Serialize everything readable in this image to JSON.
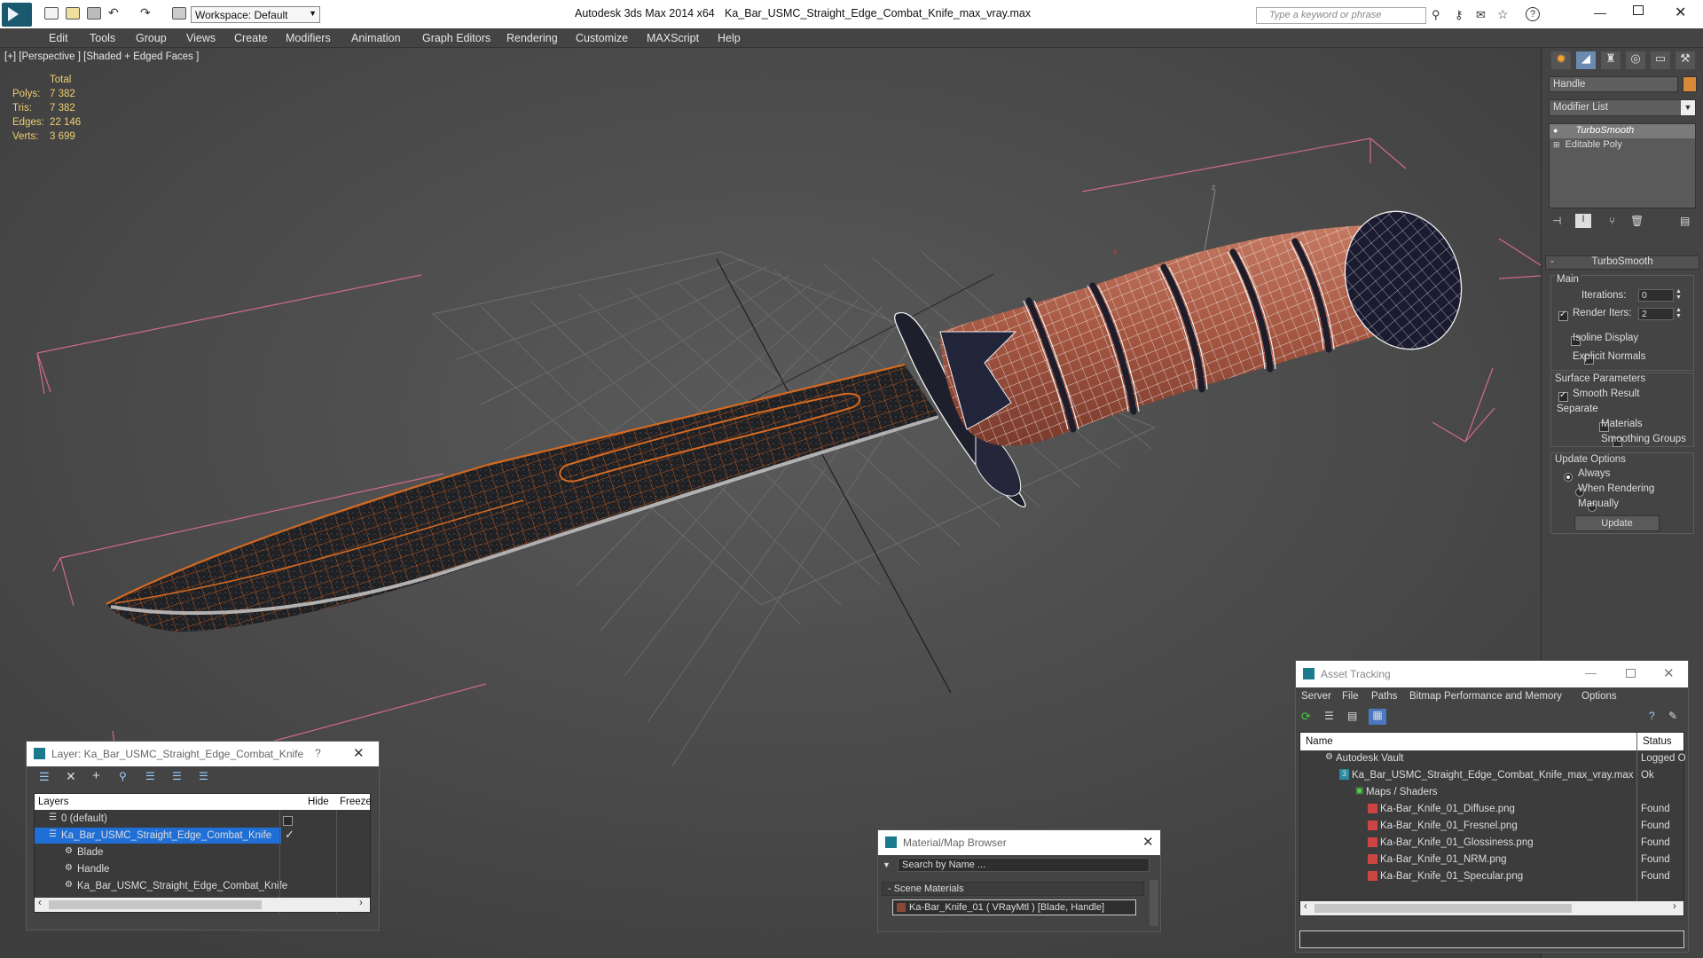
{
  "titlebar": {
    "workspace": "Workspace: Default",
    "app_title": "Autodesk 3ds Max  2014 x64",
    "file_title": "Ka_Bar_USMC_Straight_Edge_Combat_Knife_max_vray.max",
    "search_placeholder": "Type a keyword or phrase"
  },
  "menubar": [
    "Edit",
    "Tools",
    "Group",
    "Views",
    "Create",
    "Modifiers",
    "Animation",
    "Graph Editors",
    "Rendering",
    "Customize",
    "MAXScript",
    "Help"
  ],
  "viewport": {
    "label": "[+] [Perspective ] [Shaded + Edged Faces ]",
    "stats_header": "Total",
    "stats": [
      {
        "label": "Polys:",
        "value": "7 382"
      },
      {
        "label": "Tris:",
        "value": "7 382"
      },
      {
        "label": "Edges:",
        "value": "22 146"
      },
      {
        "label": "Verts:",
        "value": "3 699"
      }
    ],
    "axis_x": "x",
    "axis_z": "z"
  },
  "cmdpanel": {
    "object_name": "Handle",
    "modifier_list": "Modifier List",
    "stack": [
      "TurboSmooth",
      "Editable Poly"
    ],
    "rollout_title": "TurboSmooth",
    "main_label": "Main",
    "iterations_label": "Iterations:",
    "iterations_value": "0",
    "render_iters_label": "Render Iters:",
    "render_iters_value": "2",
    "isoline": "Isoline Display",
    "explicit_normals": "Explicit Normals",
    "surface_params": "Surface Parameters",
    "smooth_result": "Smooth Result",
    "separate": "Separate",
    "materials": "Materials",
    "smoothing_groups": "Smoothing Groups",
    "update_options": "Update Options",
    "always": "Always",
    "when_rendering": "When Rendering",
    "manually": "Manually",
    "update_btn": "Update"
  },
  "layer_win": {
    "title": "Layer: Ka_Bar_USMC_Straight_Edge_Combat_Knife",
    "help": "?",
    "col_layers": "Layers",
    "col_hide": "Hide",
    "col_freeze": "Freeze",
    "rows": [
      "0 (default)",
      "Ka_Bar_USMC_Straight_Edge_Combat_Knife",
      "Blade",
      "Handle",
      "Ka_Bar_USMC_Straight_Edge_Combat_Knife"
    ]
  },
  "mat_browser": {
    "title": "Material/Map Browser",
    "search_placeholder": "Search by Name ...",
    "section": "- Scene Materials",
    "material": "Ka-Bar_Knife_01  ( VRayMtl ) [Blade, Handle]"
  },
  "asset_win": {
    "title": "Asset Tracking",
    "menus": [
      "Server",
      "File",
      "Paths",
      "Bitmap Performance and Memory",
      "Options"
    ],
    "col_name": "Name",
    "col_status": "Status",
    "rows": [
      {
        "name": "Autodesk Vault",
        "status": "Logged O"
      },
      {
        "name": "Ka_Bar_USMC_Straight_Edge_Combat_Knife_max_vray.max",
        "status": "Ok"
      },
      {
        "name": "Maps / Shaders",
        "status": ""
      },
      {
        "name": "Ka-Bar_Knife_01_Diffuse.png",
        "status": "Found"
      },
      {
        "name": "Ka-Bar_Knife_01_Fresnel.png",
        "status": "Found"
      },
      {
        "name": "Ka-Bar_Knife_01_Glossiness.png",
        "status": "Found"
      },
      {
        "name": "Ka-Bar_Knife_01_NRM.png",
        "status": "Found"
      },
      {
        "name": "Ka-Bar_Knife_01_Specular.png",
        "status": "Found"
      }
    ]
  }
}
